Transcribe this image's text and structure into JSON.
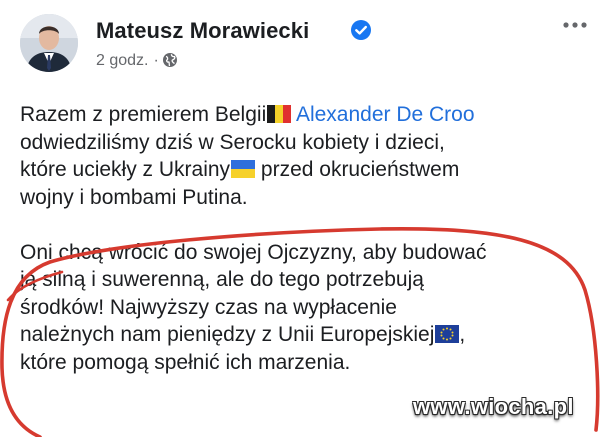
{
  "post": {
    "author": "Mateusz Morawiecki",
    "time": "2 godz.",
    "separator": "·",
    "lines": {
      "l1_pre": "Razem z premierem Belgii",
      "l1_mention": "Alexander De Croo",
      "l2": "odwiedziliśmy dziś w Serocku kobiety i dzieci,",
      "l3_pre": "które uciekły z Ukrainy",
      "l3_post": " przed okrucieństwem",
      "l4": "wojny i bombami Putina.",
      "l5": "Oni chcą wrócić do swojej Ojczyzny, aby budować",
      "l6": "ją silną i suwerenną, ale do tego potrzebują",
      "l7": "środków! Najwyższy czas na wypłacenie",
      "l8_pre": "należnych nam pieniędzy z Unii Europejskiej",
      "l8_post": ",",
      "l9": "które pomogą spełnić ich marzenia."
    }
  },
  "icons": {
    "verified": "verified-badge-icon",
    "audience": "globe-icon",
    "more": "more-options-icon",
    "flag_belgium": "belgium-flag-emoji",
    "flag_ukraine": "ukraine-flag-emoji",
    "flag_eu": "eu-flag-emoji"
  },
  "colors": {
    "mention": "#216fdb",
    "verified": "#1877f2",
    "meta": "#65676b",
    "annotation": "#d63a2f"
  },
  "watermark": "www.wiocha.pl"
}
